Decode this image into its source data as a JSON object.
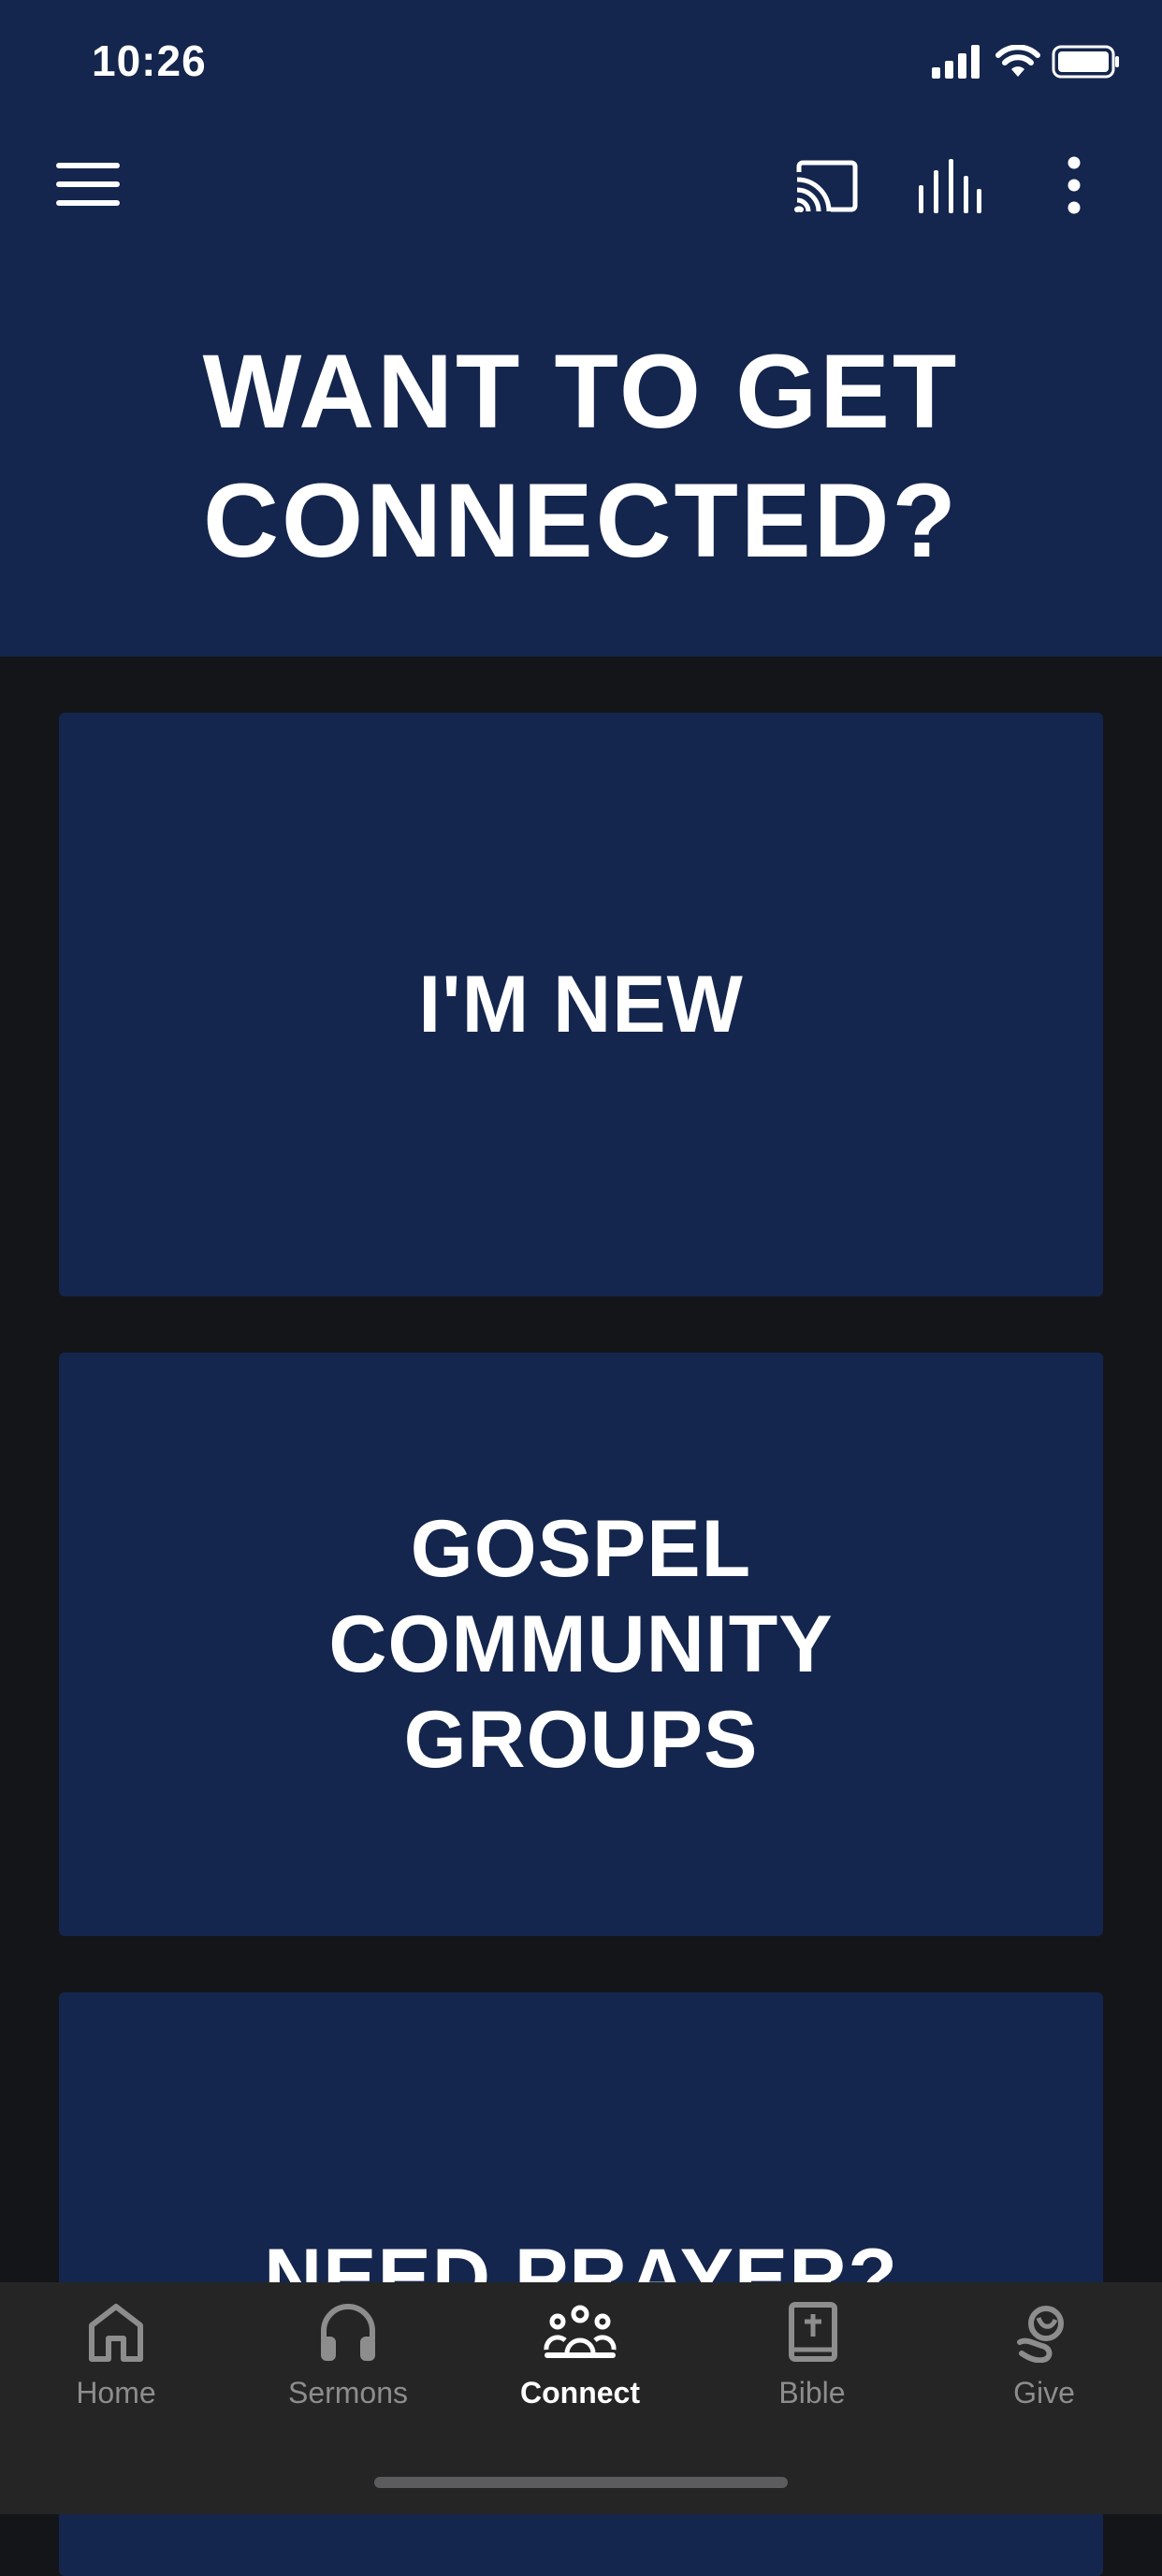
{
  "status_bar": {
    "time": "10:26"
  },
  "toolbar": {
    "menu_icon": "hamburger-menu-icon",
    "cast_icon": "cast-icon",
    "audio_icon": "audio-bars-icon",
    "more_icon": "more-vertical-icon"
  },
  "hero": {
    "title_line1": "WANT TO GET",
    "title_line2": "CONNECTED?"
  },
  "cards": [
    {
      "lines": [
        "I'M NEW"
      ]
    },
    {
      "lines": [
        "GOSPEL",
        "COMMUNITY",
        "GROUPS"
      ]
    },
    {
      "lines": [
        "NEED PRAYER?"
      ]
    }
  ],
  "tabs": [
    {
      "label": "Home",
      "icon": "home-icon"
    },
    {
      "label": "Sermons",
      "icon": "headphones-icon"
    },
    {
      "label": "Connect",
      "icon": "people-group-icon",
      "active": true
    },
    {
      "label": "Bible",
      "icon": "bible-icon"
    },
    {
      "label": "Give",
      "icon": "give-icon"
    }
  ],
  "colors": {
    "brand_navy": "#14264d",
    "background": "#141518",
    "tabbar": "#252526",
    "tab_inactive": "#8d8d8e",
    "tab_active": "#ffffff"
  }
}
